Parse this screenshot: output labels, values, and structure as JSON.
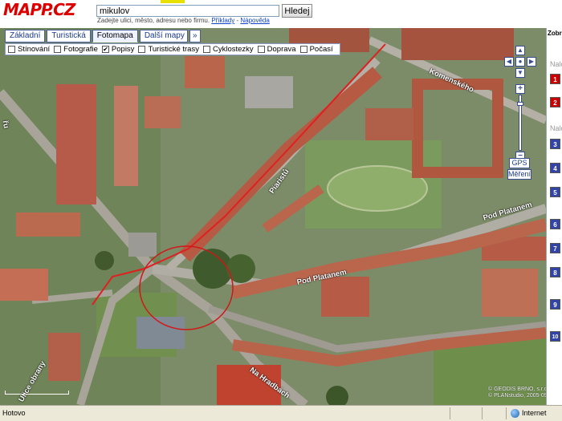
{
  "header": {
    "logo": "MAPP.CZ",
    "search_value": "mikulov",
    "search_button": "Hledej",
    "hint_text": "Zadejte ulici, město, adresu nebo firmu.",
    "hint_examples": "Příklady",
    "hint_help": "Nápověda",
    "hint_separator": "-"
  },
  "map_tabs": {
    "items": [
      "Základní",
      "Turistická",
      "Fotomapa",
      "Další mapy",
      "»"
    ],
    "active": "Fotomapa"
  },
  "layers": [
    {
      "label": "Stínování",
      "checked": false
    },
    {
      "label": "Fotografie",
      "checked": false
    },
    {
      "label": "Popisy",
      "checked": true
    },
    {
      "label": "Turistické trasy",
      "checked": false
    },
    {
      "label": "Cyklostezky",
      "checked": false
    },
    {
      "label": "Doprava",
      "checked": false
    },
    {
      "label": "Počasí",
      "checked": false
    }
  ],
  "streets": {
    "komenskeho": "Komenského",
    "piaristu": "Piaristů",
    "pod_platanem_right": "Pod Platanem",
    "pod_platanem_center": "Pod Platanem",
    "na_hradbach": "Na Hradbách",
    "left_street": "Ulice obrany",
    "left_top": "řu"
  },
  "controls": {
    "gps": "GPS",
    "mereni": "Měření",
    "zoom_in": "+",
    "zoom_out": "−"
  },
  "copyright": {
    "line1": "© GEODIS BRNO, s.r.o.",
    "line2": "© PLANstudio, 2005-09"
  },
  "side_panel": {
    "header": "Zobr",
    "section1": "Nalo",
    "section2": "Nalo",
    "red_badges": [
      "1",
      "2"
    ],
    "blue_badges": [
      "3",
      "4",
      "5",
      "6",
      "7",
      "8",
      "9",
      "10"
    ]
  },
  "status_bar": {
    "text": "Hotovo",
    "zone": "Internet"
  }
}
